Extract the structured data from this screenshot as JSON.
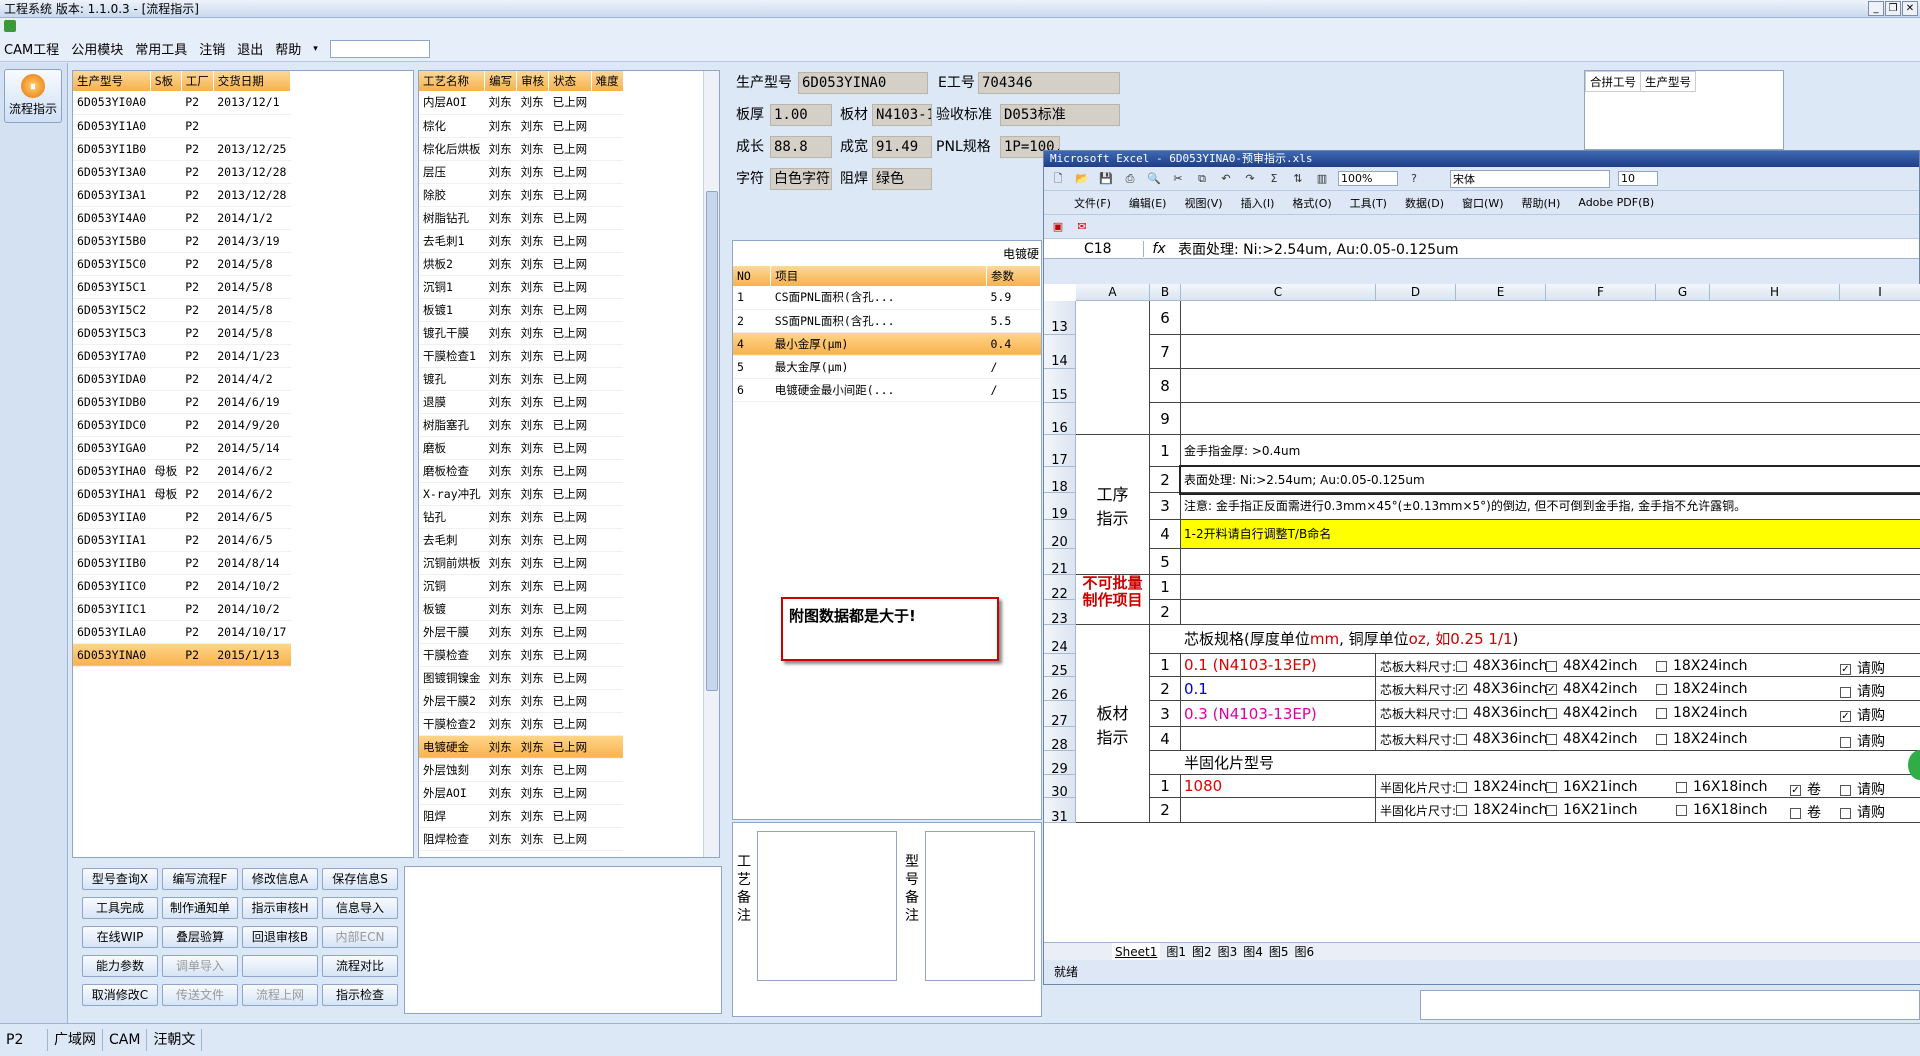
{
  "window": {
    "title": "工程系统    版本: 1.1.0.3 - [流程指示]"
  },
  "menu": [
    "CAM工程",
    "公用模块",
    "常用工具",
    "注销",
    "退出",
    "帮助"
  ],
  "leftbar": {
    "flow_label": "流程指示"
  },
  "models": {
    "headers": [
      "生产型号",
      "S板",
      "工厂",
      "交货日期"
    ],
    "rows": [
      [
        "6D053YI0A0",
        "",
        "P2",
        "2013/12/1"
      ],
      [
        "6D053YI1A0",
        "",
        "P2",
        ""
      ],
      [
        "6D053YI1B0",
        "",
        "P2",
        "2013/12/25"
      ],
      [
        "6D053YI3A0",
        "",
        "P2",
        "2013/12/28"
      ],
      [
        "6D053YI3A1",
        "",
        "P2",
        "2013/12/28"
      ],
      [
        "6D053YI4A0",
        "",
        "P2",
        "2014/1/2"
      ],
      [
        "6D053YI5B0",
        "",
        "P2",
        "2014/3/19"
      ],
      [
        "6D053YI5C0",
        "",
        "P2",
        "2014/5/8"
      ],
      [
        "6D053YI5C1",
        "",
        "P2",
        "2014/5/8"
      ],
      [
        "6D053YI5C2",
        "",
        "P2",
        "2014/5/8"
      ],
      [
        "6D053YI5C3",
        "",
        "P2",
        "2014/5/8"
      ],
      [
        "6D053YI7A0",
        "",
        "P2",
        "2014/1/23"
      ],
      [
        "6D053YIDA0",
        "",
        "P2",
        "2014/4/2"
      ],
      [
        "6D053YIDB0",
        "",
        "P2",
        "2014/6/19"
      ],
      [
        "6D053YIDC0",
        "",
        "P2",
        "2014/9/20"
      ],
      [
        "6D053YIGA0",
        "",
        "P2",
        "2014/5/14"
      ],
      [
        "6D053YIHA0",
        "母板",
        "P2",
        "2014/6/2"
      ],
      [
        "6D053YIHA1",
        "母板",
        "P2",
        "2014/6/2"
      ],
      [
        "6D053YIIA0",
        "",
        "P2",
        "2014/6/5"
      ],
      [
        "6D053YIIA1",
        "",
        "P2",
        "2014/6/5"
      ],
      [
        "6D053YIIB0",
        "",
        "P2",
        "2014/8/14"
      ],
      [
        "6D053YIIC0",
        "",
        "P2",
        "2014/10/2"
      ],
      [
        "6D053YIIC1",
        "",
        "P2",
        "2014/10/2"
      ],
      [
        "6D053YILA0",
        "",
        "P2",
        "2014/10/17"
      ],
      [
        "6D053YINA0",
        "",
        "P2",
        "2015/1/13"
      ]
    ],
    "selected": 24
  },
  "process": {
    "headers": [
      "工艺名称",
      "编写",
      "审核",
      "状态",
      "难度"
    ],
    "rows": [
      [
        "内层AOI",
        "刘东",
        "刘东",
        "已上网"
      ],
      [
        "棕化",
        "刘东",
        "刘东",
        "已上网"
      ],
      [
        "棕化后烘板",
        "刘东",
        "刘东",
        "已上网"
      ],
      [
        "层压",
        "刘东",
        "刘东",
        "已上网"
      ],
      [
        "除胶",
        "刘东",
        "刘东",
        "已上网"
      ],
      [
        "树脂钻孔",
        "刘东",
        "刘东",
        "已上网"
      ],
      [
        "去毛刺1",
        "刘东",
        "刘东",
        "已上网"
      ],
      [
        "烘板2",
        "刘东",
        "刘东",
        "已上网"
      ],
      [
        "沉铜1",
        "刘东",
        "刘东",
        "已上网"
      ],
      [
        "板镀1",
        "刘东",
        "刘东",
        "已上网"
      ],
      [
        "镀孔干膜",
        "刘东",
        "刘东",
        "已上网"
      ],
      [
        "干膜检查1",
        "刘东",
        "刘东",
        "已上网"
      ],
      [
        "镀孔",
        "刘东",
        "刘东",
        "已上网"
      ],
      [
        "退膜",
        "刘东",
        "刘东",
        "已上网"
      ],
      [
        "树脂塞孔",
        "刘东",
        "刘东",
        "已上网"
      ],
      [
        "磨板",
        "刘东",
        "刘东",
        "已上网"
      ],
      [
        "磨板检查",
        "刘东",
        "刘东",
        "已上网"
      ],
      [
        "X-ray冲孔",
        "刘东",
        "刘东",
        "已上网"
      ],
      [
        "钻孔",
        "刘东",
        "刘东",
        "已上网"
      ],
      [
        "去毛刺",
        "刘东",
        "刘东",
        "已上网"
      ],
      [
        "沉铜前烘板",
        "刘东",
        "刘东",
        "已上网"
      ],
      [
        "沉铜",
        "刘东",
        "刘东",
        "已上网"
      ],
      [
        "板镀",
        "刘东",
        "刘东",
        "已上网"
      ],
      [
        "外层干膜",
        "刘东",
        "刘东",
        "已上网"
      ],
      [
        "干膜检查",
        "刘东",
        "刘东",
        "已上网"
      ],
      [
        "图镀铜镍金",
        "刘东",
        "刘东",
        "已上网"
      ],
      [
        "外层干膜2",
        "刘东",
        "刘东",
        "已上网"
      ],
      [
        "干膜检查2",
        "刘东",
        "刘东",
        "已上网"
      ],
      [
        "电镀硬金",
        "刘东",
        "刘东",
        "已上网"
      ],
      [
        "外层蚀刻",
        "刘东",
        "刘东",
        "已上网"
      ],
      [
        "外层AOI",
        "刘东",
        "刘东",
        "已上网"
      ],
      [
        "阻焊",
        "刘东",
        "刘东",
        "已上网"
      ],
      [
        "阻焊检查",
        "刘东",
        "刘东",
        "已上网"
      ]
    ],
    "selected": 28
  },
  "buttons": [
    [
      "型号查询X",
      "编写流程F",
      "修改信息A",
      "保存信息S"
    ],
    [
      "工具完成",
      "制作通知单",
      "指示审核H",
      "信息导入"
    ],
    [
      "在线WIP",
      "叠层验算",
      "回退审核B",
      "内部ECN"
    ],
    [
      "能力参数",
      "调单导入",
      "",
      "流程对比"
    ],
    [
      "取消修改C",
      "传送文件",
      "流程上网",
      "指示检查"
    ]
  ],
  "disabled_buttons": [
    "内部ECN",
    "调单导入",
    "传送文件",
    "流程上网"
  ],
  "info": {
    "model_label": "生产型号",
    "model": "6D053YINA0",
    "eno_label": "E工号",
    "eno": "704346",
    "thick_label": "板厚",
    "thick": "1.00",
    "mat_label": "板材",
    "mat": "N4103-1",
    "std_label": "验收标准",
    "std": "D053标准",
    "len_label": "成长",
    "len": "88.8",
    "wid_label": "成宽",
    "wid": "91.49",
    "pnl_label": "PNL规格",
    "pnl": "1P=100.10U",
    "char_label": "字符",
    "char": "白色字符",
    "mask_label": "阻焊",
    "mask": "绿色"
  },
  "merge": {
    "headers": [
      "合拼工号",
      "生产型号"
    ]
  },
  "params": {
    "title": "电镀硬",
    "headers": [
      "NO",
      "项目",
      "参数"
    ],
    "rows": [
      [
        "1",
        "CS面PNL面积(含孔...",
        "5.9"
      ],
      [
        "2",
        "SS面PNL面积(含孔...",
        "5.5"
      ],
      [
        "4",
        "最小金厚(μm)",
        "0.4"
      ],
      [
        "5",
        "最大金厚(μm)",
        "/"
      ],
      [
        "6",
        "电镀硬金最小间距(...",
        "/"
      ]
    ],
    "selected": 2
  },
  "note_box": "附图数据都是大于!",
  "remarks": {
    "proc": "工艺备注",
    "model": "型号备注"
  },
  "excel": {
    "title": "Microsoft Excel - 6D053YINA0-预审指示.xls",
    "menu": [
      "文件(F)",
      "编辑(E)",
      "视图(V)",
      "插入(I)",
      "格式(O)",
      "工具(T)",
      "数据(D)",
      "窗口(W)",
      "帮助(H)",
      "Adobe PDF(B)"
    ],
    "zoom": "100%",
    "font": "宋体",
    "fontsize": "10",
    "cellref": "C18",
    "formula": "表面处理: Ni:>2.54um, Au:0.05-0.125um",
    "cols": [
      "A",
      "B",
      "C",
      "D",
      "E",
      "F",
      "G",
      "H",
      "I"
    ],
    "rownums": [
      "13",
      "14",
      "15",
      "16",
      "17",
      "18",
      "19",
      "20",
      "21",
      "22",
      "23",
      "24",
      "25",
      "26",
      "27",
      "28",
      "29",
      "30",
      "31"
    ],
    "b_nums": [
      "6",
      "7",
      "8",
      "9",
      "1",
      "2",
      "3",
      "4",
      "5",
      "1",
      "2",
      "",
      "1",
      "2",
      "3",
      "4",
      "",
      "1",
      "2"
    ],
    "sec_process": "工序指示",
    "sec_forbid": "不可批量制作项目",
    "sec_board": "板材指示",
    "r17": "金手指金厚: >0.4um",
    "r18": "表面处理: Ni:>2.54um; Au:0.05-0.125um",
    "r19": "注意: 金手指正反面需进行0.3mm×45°(±0.13mm×5°)的倒边, 但不可倒到金手指, 金手指不允许露铜。",
    "r20": "1-2开料请自行调整T/B命名",
    "core_title": "芯板规格(厚度单位",
    "core_mm": "mm",
    "core_mid": ", 铜厚单位",
    "core_oz": "oz",
    "core_eg": ", 如0.25 1/1",
    "core_close": ")",
    "core_rows": [
      "0.1 (N4103-13EP)",
      "0.1",
      "0.3 (N4103-13EP)",
      ""
    ],
    "core_label": "芯板大料尺寸:",
    "core_opts": [
      "48X36inch",
      "48X42inch",
      "18X24inch",
      "请购"
    ],
    "core_checks": [
      [
        false,
        false,
        false,
        true
      ],
      [
        true,
        true,
        false,
        false
      ],
      [
        false,
        false,
        false,
        true
      ],
      [
        false,
        false,
        false,
        false
      ]
    ],
    "pp_title": "半固化片型号",
    "pp_rows": [
      "1080",
      ""
    ],
    "pp_label": "半固化片尺寸:",
    "pp_opts": [
      "18X24inch",
      "16X21inch",
      "16X18inch",
      "卷",
      "请购"
    ],
    "pp_checks": [
      [
        false,
        false,
        false,
        true,
        false
      ],
      [
        false,
        false,
        false,
        false,
        false
      ]
    ],
    "tabs": [
      "Sheet1",
      "图1",
      "图2",
      "图3",
      "图4",
      "图5",
      "图6"
    ],
    "status": "就绪"
  },
  "statusbar": [
    "P2",
    "广域网",
    "CAM",
    "汪朝文"
  ]
}
